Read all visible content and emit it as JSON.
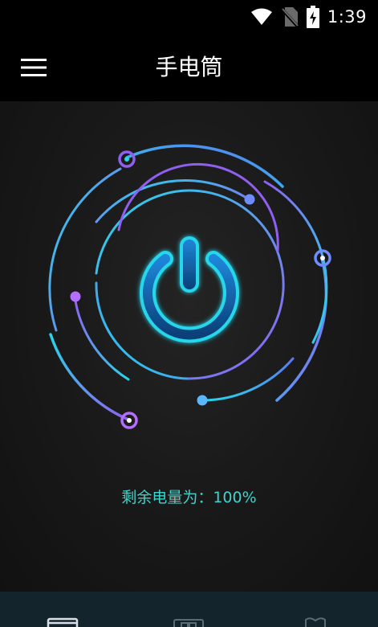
{
  "status_bar": {
    "time": "1:39",
    "icons": [
      "wifi-icon",
      "no-sim-icon",
      "battery-charging-icon"
    ]
  },
  "app_bar": {
    "title": "手电筒",
    "menu_icon": "hamburger-menu-icon"
  },
  "flashlight": {
    "state": "off",
    "icon": "power-icon"
  },
  "battery": {
    "label": "剩余电量为：100%",
    "level_percent": 100
  },
  "bottom_nav": {
    "items": [
      {
        "icon": "flashlight-tab-icon"
      },
      {
        "icon": "grid-tab-icon"
      },
      {
        "icon": "shield-tab-icon"
      }
    ]
  },
  "colors": {
    "accent_cyan": "#27d6ea",
    "accent_purple": "#8f5ff0",
    "accent_blue": "#5a78f0",
    "battery_text": "#3fd3cc",
    "nav_background": "#14242d"
  }
}
